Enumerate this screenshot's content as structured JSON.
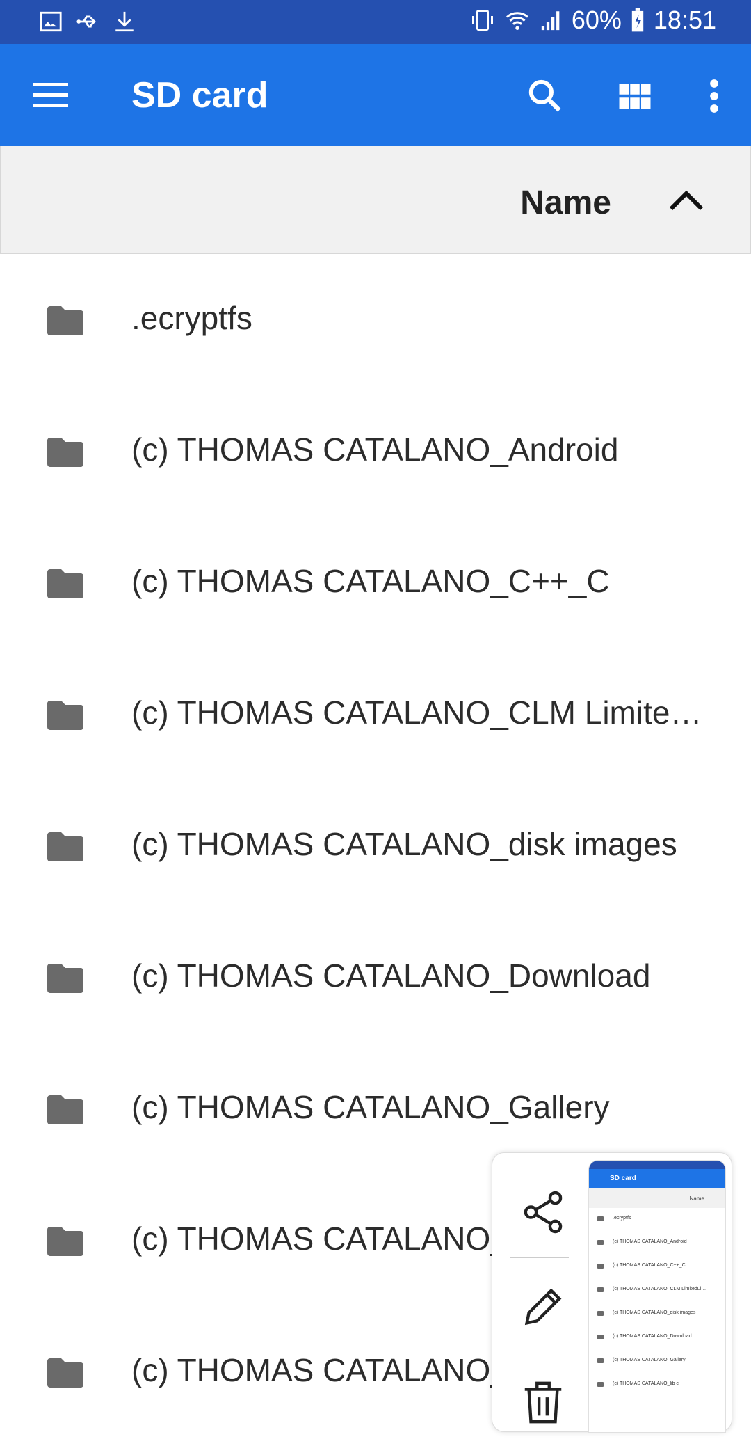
{
  "status_bar": {
    "battery": "60%",
    "time": "18:51",
    "icons_left": [
      "image-icon",
      "usb-icon",
      "download-icon"
    ],
    "icons_right": [
      "vibrate-icon",
      "wifi-icon",
      "signal-icon",
      "battery-charging-icon"
    ]
  },
  "app_bar": {
    "title": "SD card",
    "actions": [
      "search-icon",
      "grid-view-icon",
      "more-vert-icon"
    ]
  },
  "sort_bar": {
    "label": "Name",
    "direction_icon": "chevron-up-icon"
  },
  "files": [
    {
      "name": ".ecryptfs"
    },
    {
      "name": "(c) THOMAS CATALANO_Android"
    },
    {
      "name": "(c) THOMAS CATALANO_C++_C"
    },
    {
      "name": "(c) THOMAS CATALANO_CLM LimitedLi…"
    },
    {
      "name": "(c) THOMAS CATALANO_disk images"
    },
    {
      "name": "(c) THOMAS CATALANO_Download"
    },
    {
      "name": "(c) THOMAS CATALANO_Gallery"
    },
    {
      "name": "(c) THOMAS CATALANO_"
    },
    {
      "name": "(c) THOMAS CATALANO_"
    }
  ],
  "screenshot_popup": {
    "actions": [
      "share-icon",
      "edit-icon",
      "delete-icon"
    ],
    "preview": {
      "title": "SD card",
      "sort_label": "Name",
      "items": [
        ".ecryptfs",
        "(c) THOMAS CATALANO_Android",
        "(c) THOMAS CATALANO_C++_C",
        "(c) THOMAS CATALANO_CLM LimitedLi…",
        "(c) THOMAS CATALANO_disk images",
        "(c) THOMAS CATALANO_Download",
        "(c) THOMAS CATALANO_Gallery",
        "(c) THOMAS CATALANO_lib c"
      ]
    }
  },
  "colors": {
    "status_bar": "#2550b0",
    "app_bar": "#1e74e6",
    "folder_icon": "#6a6a6a"
  }
}
